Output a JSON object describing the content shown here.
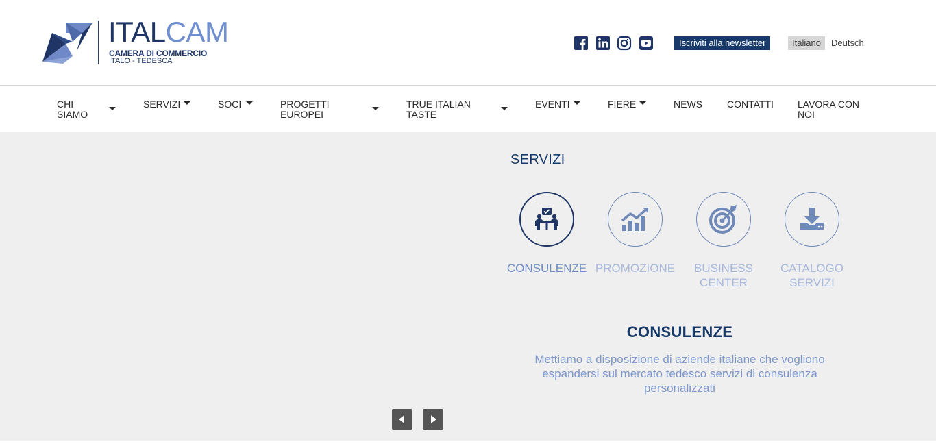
{
  "header": {
    "logo": {
      "word_part1": "ITAL",
      "word_part2": "CAM",
      "line1": "CAMERA DI COMMERCIO",
      "line2": "ITALO - TEDESCA"
    },
    "social": [
      "facebook-icon",
      "linkedin-icon",
      "instagram-icon",
      "youtube-icon"
    ],
    "newsletter_label": "Iscriviti alla newsletter",
    "languages": {
      "active": "Italiano",
      "other": "Deutsch"
    }
  },
  "nav": {
    "items": [
      {
        "label": "CHI\nSIAMO",
        "l1": "CHI",
        "l2": "SIAMO",
        "dropdown": true
      },
      {
        "label": "SERVIZI",
        "dropdown": true
      },
      {
        "label": "SOCI",
        "dropdown": true
      },
      {
        "l1": "PROGETTI",
        "l2": "EUROPEI",
        "dropdown": true
      },
      {
        "l1": "TRUE ITALIAN",
        "l2": "TASTE",
        "dropdown": true
      },
      {
        "label": "EVENTI",
        "dropdown": true
      },
      {
        "label": "FIERE",
        "dropdown": true
      },
      {
        "label": "NEWS",
        "dropdown": false
      },
      {
        "label": "CONTATTI",
        "dropdown": false
      },
      {
        "l1": "LAVORA CON",
        "l2": "NOI",
        "dropdown": false
      }
    ]
  },
  "services": {
    "title": "SERVIZI",
    "items": [
      {
        "label": "CONSULENZE",
        "icon": "consulting-icon",
        "active": true
      },
      {
        "label": "PROMOZIONE",
        "icon": "growth-chart-icon",
        "active": false
      },
      {
        "label": "BUSINESS CENTER",
        "icon": "target-icon",
        "active": false
      },
      {
        "label": "CATALOGO SERVIZI",
        "icon": "download-icon",
        "active": false
      }
    ],
    "detail": {
      "title": "CONSULENZE",
      "text": "Mettiamo a disposizione di aziende italiane che vogliono espandersi sul mercato tedesco servizi di consulenza personalizzati"
    }
  },
  "colors": {
    "brand_dark": "#1f3566",
    "brand_light": "#6f8fd0",
    "newsletter_bg": "#173a6b",
    "content_bg": "#efefef"
  }
}
